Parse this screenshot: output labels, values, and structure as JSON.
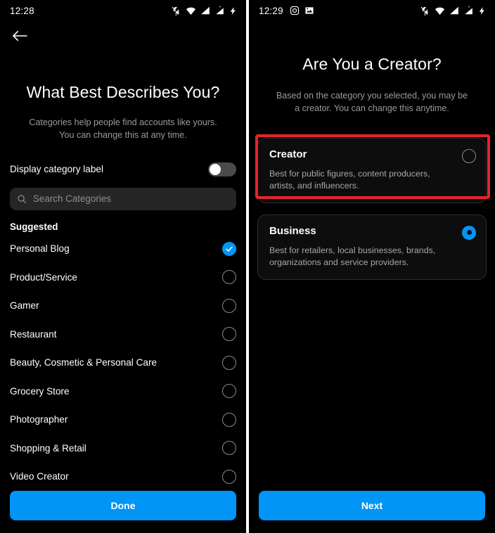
{
  "left_screen": {
    "status_bar": {
      "time": "12:28",
      "left_icons": [],
      "right_icons": [
        "bell-off-icon",
        "wifi-icon",
        "signal-icon",
        "signal-no-sim-icon",
        "charging-bolt-icon"
      ]
    },
    "back_button": "back-arrow-icon",
    "title": "What Best Describes You?",
    "subtitle": "Categories help people find accounts like yours. You can change this at any time.",
    "toggle": {
      "label": "Display category label",
      "state": "off"
    },
    "search": {
      "placeholder": "Search Categories",
      "value": "",
      "icon": "search-icon"
    },
    "section_header": "Suggested",
    "categories": [
      {
        "label": "Personal Blog",
        "selected": true
      },
      {
        "label": "Product/Service",
        "selected": false
      },
      {
        "label": "Gamer",
        "selected": false
      },
      {
        "label": "Restaurant",
        "selected": false
      },
      {
        "label": "Beauty, Cosmetic & Personal Care",
        "selected": false
      },
      {
        "label": "Grocery Store",
        "selected": false
      },
      {
        "label": "Photographer",
        "selected": false
      },
      {
        "label": "Shopping & Retail",
        "selected": false
      },
      {
        "label": "Video Creator",
        "selected": false
      }
    ],
    "cta": "Done"
  },
  "right_screen": {
    "status_bar": {
      "time": "12:29",
      "left_icons": [
        "instagram-icon",
        "image-icon"
      ],
      "right_icons": [
        "bell-off-icon",
        "wifi-icon",
        "signal-icon",
        "signal-no-sim-icon",
        "charging-bolt-icon"
      ]
    },
    "title": "Are You a Creator?",
    "subtitle": "Based on the category you selected, you may be a creator. You can change this anytime.",
    "cards": [
      {
        "title": "Creator",
        "description": "Best for public figures, content producers, artists, and influencers.",
        "selected": false,
        "highlighted": false
      },
      {
        "title": "Business",
        "description": "Best for retailers, local businesses, brands, organizations and service providers.",
        "selected": true,
        "highlighted": true
      }
    ],
    "cta": "Next"
  },
  "colors": {
    "accent_blue": "#0095f6",
    "highlight_red": "#e8232a",
    "background": "#000000",
    "card_background": "#0d0d0d",
    "muted_text": "#9a9a9a"
  }
}
